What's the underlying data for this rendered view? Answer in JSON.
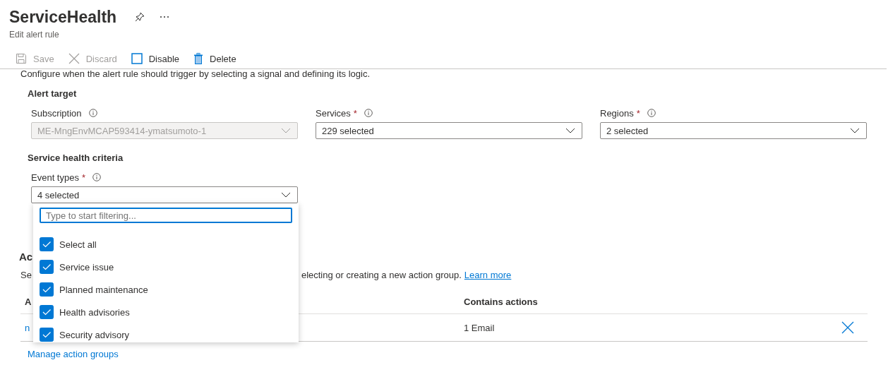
{
  "header": {
    "title": "ServiceHealth",
    "subtitle": "Edit alert rule"
  },
  "toolbar": [
    {
      "label": "Save",
      "kind": "save",
      "disabled": true
    },
    {
      "label": "Discard",
      "kind": "discard",
      "disabled": true
    },
    {
      "label": "Disable",
      "kind": "disable",
      "disabled": false
    },
    {
      "label": "Delete",
      "kind": "delete",
      "disabled": false
    }
  ],
  "intro": "Configure when the alert rule should trigger by selecting a signal and defining its logic.",
  "alert_target": {
    "heading": "Alert target",
    "fields": [
      {
        "label": "Subscription",
        "value": "ME-MngEnvMCAP593414-ymatsumoto-1",
        "disabled": true
      },
      {
        "label": "Services",
        "required_mark": "*",
        "value": "229 selected",
        "disabled": false
      },
      {
        "label": "Regions",
        "required_mark": "*",
        "value": "2 selected",
        "disabled": false
      }
    ]
  },
  "criteria": {
    "heading": "Service health criteria",
    "field": {
      "label": "Event types",
      "required_mark": "*",
      "value": "4 selected",
      "expanded": true
    }
  },
  "dropdown": {
    "placeholder": "Type to start filtering...",
    "options": [
      {
        "label": "Select all",
        "checked": true
      },
      {
        "label": "Service issue",
        "checked": true
      },
      {
        "label": "Planned maintenance",
        "checked": true
      },
      {
        "label": "Health advisories",
        "checked": true
      },
      {
        "label": "Security advisory",
        "checked": true
      }
    ]
  },
  "actions": {
    "heading": "Ac",
    "description_start": "Se",
    "description_end": "electing or creating a new action group.",
    "link": "Learn more",
    "columns": [
      "A",
      "Contains actions"
    ],
    "rows": [
      {
        "cells": [
          "n",
          "1 Email"
        ]
      }
    ],
    "manage_link": "Manage action groups"
  }
}
